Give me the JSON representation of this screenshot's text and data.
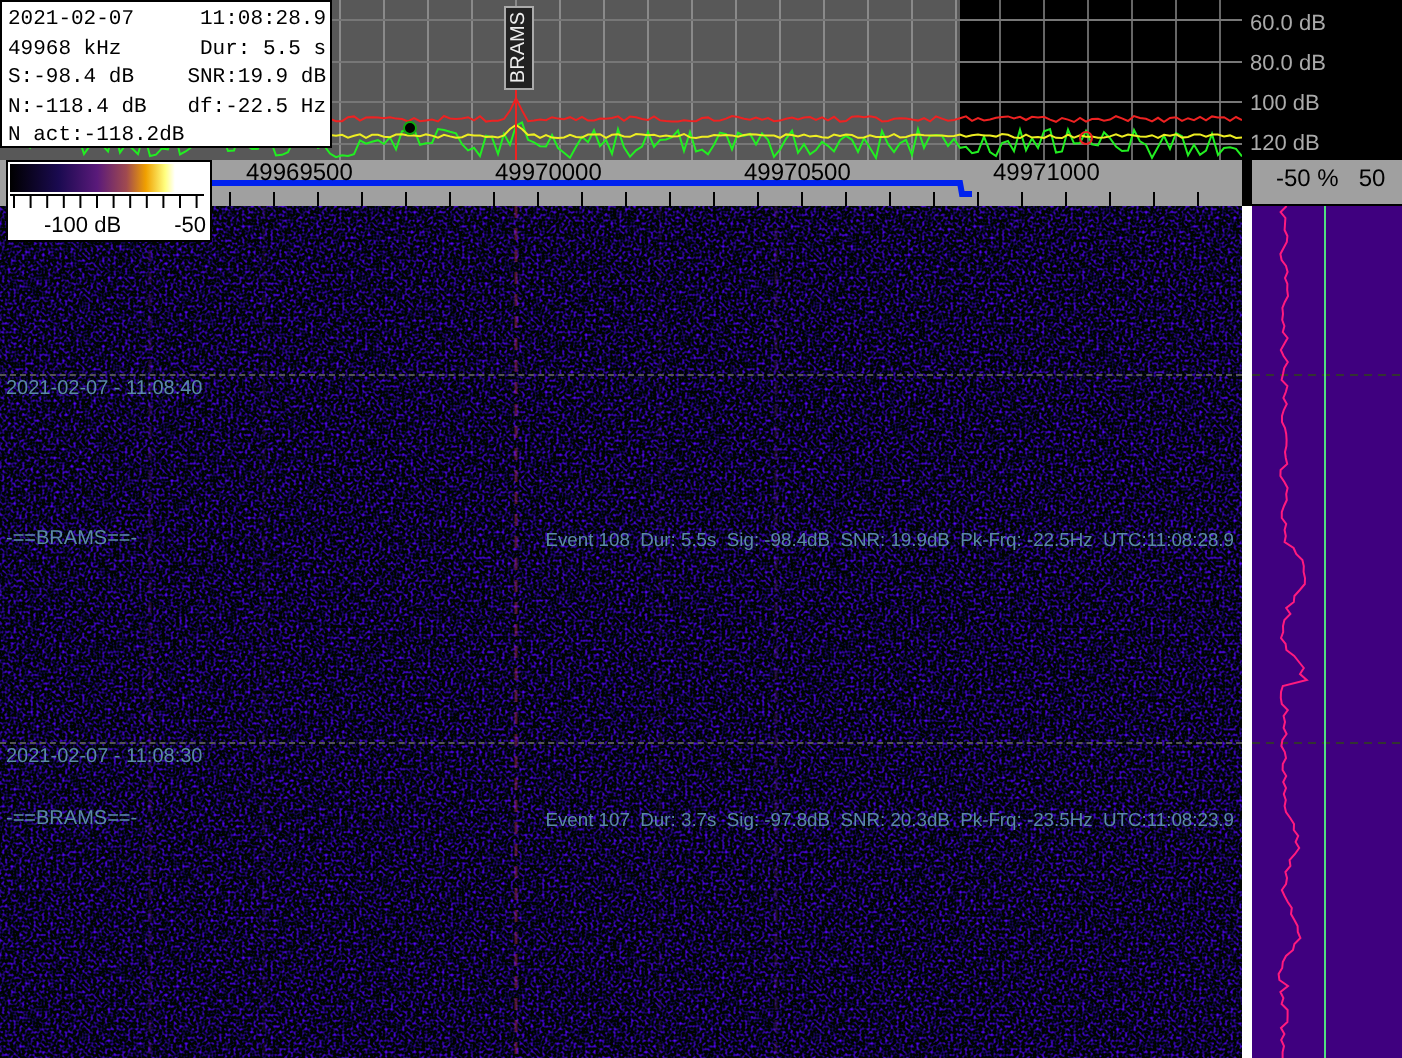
{
  "info_box": {
    "rows": [
      [
        "2021-02-07",
        "11:08:28.9"
      ],
      [
        "49968 kHz",
        "Dur: 5.5 s"
      ],
      [
        "S:-98.4 dB",
        "SNR:19.9 dB"
      ],
      [
        "N:-118.4 dB",
        "df:-22.5 Hz"
      ],
      [
        "N act:-118.2dB"
      ]
    ]
  },
  "spectrum": {
    "marker_label": "BRAMS",
    "db_labels": [
      "60.0 dB",
      "80.0 dB",
      "100 dB",
      "120 dB"
    ]
  },
  "frequency_axis": {
    "labels": [
      "49969500",
      "49970000",
      "49970500",
      "49971000"
    ]
  },
  "colorbar": {
    "labels": [
      "-100 dB",
      "-50"
    ]
  },
  "side_panel": {
    "labels": [
      "-50 %",
      "50"
    ]
  },
  "waterfall": {
    "blocks": [
      {
        "timestamp": "2021-02-07 - 11:08:40",
        "station": "-==BRAMS==-",
        "event": "Event 108  Dur: 5.5s  Sig: -98.4dB  SNR: 19.9dB  Pk-Frq: -22.5Hz  UTC:11:08:28.9"
      },
      {
        "timestamp": "2021-02-07 - 11:08:30",
        "station": "-==BRAMS==-",
        "event": "Event 107  Dur: 3.7s  Sig: -97.8dB  SNR: 20.3dB  Pk-Frq: -23.5Hz  UTC:11:08:23.9"
      }
    ]
  }
}
